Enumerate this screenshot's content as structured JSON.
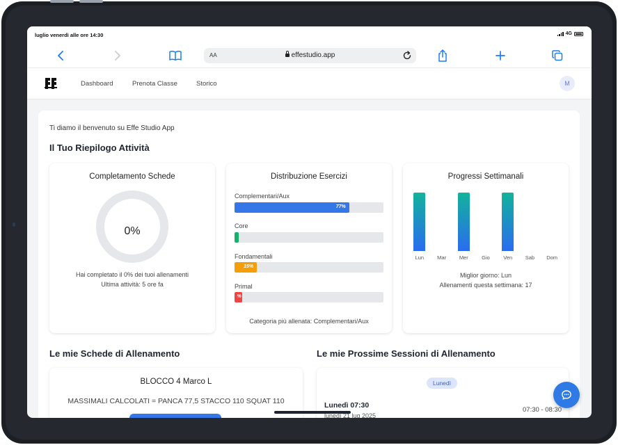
{
  "status_bar": {
    "time": "luglio venerdì alle ore 14:30",
    "network": "4G"
  },
  "browser": {
    "text_size_label": "AA",
    "url": "effestudio.app",
    "icons": [
      "back-icon",
      "forward-icon",
      "bookmarks-icon",
      "lock-icon",
      "reload-icon",
      "share-icon",
      "new-tab-icon",
      "tabs-icon"
    ]
  },
  "nav": {
    "links": [
      "Dashboard",
      "Prenota Classe",
      "Storico"
    ],
    "avatar": "M"
  },
  "welcome": "Ti diamo il benvenuto su Effe Studio App",
  "summary_title": "Il Tuo Riepilogo Attività",
  "completion": {
    "title": "Completamento Schede",
    "value": "0%",
    "value_fraction": 0,
    "text": "Hai completato il 0% dei tuoi allenamenti",
    "last_activity": "Ultima attività: 5 ore fa"
  },
  "distribution": {
    "title": "Distribuzione Esercizi",
    "items": [
      {
        "label": "Complementari/Aux",
        "percent": 77,
        "display": "77%",
        "color": "#3577e6"
      },
      {
        "label": "Core",
        "percent": 3,
        "display": "",
        "color": "#17b26a"
      },
      {
        "label": "Fondamentali",
        "percent": 15,
        "display": "15%",
        "color": "#f59e0b"
      },
      {
        "label": "Primal",
        "percent": 5,
        "display": "%",
        "color": "#ef4444"
      }
    ],
    "footer": "Categoria più allenata: Complementari/Aux"
  },
  "weekly": {
    "title": "Progressi Settimanali",
    "days": [
      "Lun",
      "Mar",
      "Mer",
      "Gio",
      "Ven",
      "Sab",
      "Dom"
    ],
    "values": [
      1,
      0,
      1,
      0,
      1,
      0,
      0
    ],
    "best_day": "Miglior giorno: Lun",
    "this_week": "Allenamenti questa settimana: 17"
  },
  "plans": {
    "section_title": "Le mie Schede di Allenamento",
    "name": "BLOCCO 4 Marco L",
    "description": "MASSIMALI CALCOLATI = PANCA 77,5 STACCO 110 SQUAT 110"
  },
  "sessions": {
    "section_title": "Le mie Prossime Sessioni di Allenamento",
    "day_badge": "Lunedì",
    "title": "Lunedì 07:30",
    "date": "lunedì 21 lug 2025",
    "time_range": "07:30 - 08:30"
  }
}
